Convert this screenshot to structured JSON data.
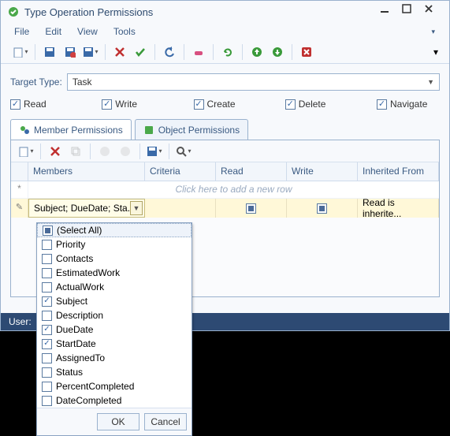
{
  "window": {
    "title": "Type Operation Permissions"
  },
  "menu": {
    "file": "File",
    "edit": "Edit",
    "view": "View",
    "tools": "Tools"
  },
  "target": {
    "label": "Target Type:",
    "value": "Task"
  },
  "perms": {
    "read": "Read",
    "write": "Write",
    "create": "Create",
    "delete": "Delete",
    "navigate": "Navigate"
  },
  "tabs": {
    "member": "Member Permissions",
    "object": "Object Permissions"
  },
  "grid": {
    "headers": {
      "members": "Members",
      "criteria": "Criteria",
      "read": "Read",
      "write": "Write",
      "inherited": "Inherited From"
    },
    "addrow": "Click here to add a new row",
    "row1": {
      "members": "Subject; DueDate; Sta...",
      "inherited": "Read is inherite..."
    }
  },
  "dropdown": {
    "options": [
      {
        "label": "(Select All)",
        "state": "mixed"
      },
      {
        "label": "Priority",
        "state": "off"
      },
      {
        "label": "Contacts",
        "state": "off"
      },
      {
        "label": "EstimatedWork",
        "state": "off"
      },
      {
        "label": "ActualWork",
        "state": "off"
      },
      {
        "label": "Subject",
        "state": "on"
      },
      {
        "label": "Description",
        "state": "off"
      },
      {
        "label": "DueDate",
        "state": "on"
      },
      {
        "label": "StartDate",
        "state": "on"
      },
      {
        "label": "AssignedTo",
        "state": "off"
      },
      {
        "label": "Status",
        "state": "off"
      },
      {
        "label": "PercentCompleted",
        "state": "off"
      },
      {
        "label": "DateCompleted",
        "state": "off"
      }
    ],
    "ok": "OK",
    "cancel": "Cancel"
  },
  "status": "User:"
}
